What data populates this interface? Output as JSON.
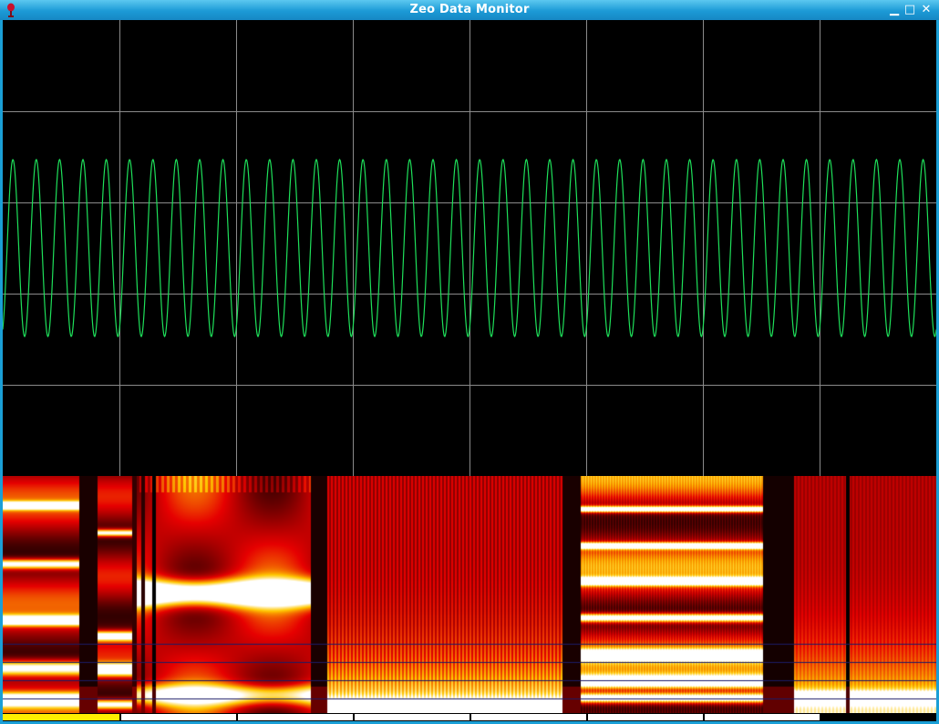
{
  "window": {
    "title": "Zeo Data Monitor",
    "frame_color": "#1a9fd6",
    "controls": [
      {
        "name": "minimize-button",
        "icon": "minimize-icon",
        "glyph": "▁"
      },
      {
        "name": "maximize-button",
        "icon": "maximize-icon",
        "glyph": "□"
      },
      {
        "name": "close-button",
        "icon": "close-icon",
        "glyph": "✕"
      }
    ]
  },
  "waveform": {
    "background": "#000000",
    "grid_color": "#8a8a8a",
    "trace_color": "#1ee05a",
    "vertical_divisions": 8,
    "horizontal_divisions": 5,
    "cycles_visible": 40,
    "amplitude_fraction_of_division": 0.97
  },
  "spectrogram": {
    "colormap": "black-red-yellow-white",
    "horizontal_rule_color": "#1a1a66"
  },
  "sleep_stage_bar": {
    "segments": 8,
    "colors": [
      "#ffee00",
      "#ffffff",
      "#ffffff",
      "#ffffff",
      "#ffffff",
      "#ffffff",
      "#ffffff",
      "#000000"
    ]
  }
}
